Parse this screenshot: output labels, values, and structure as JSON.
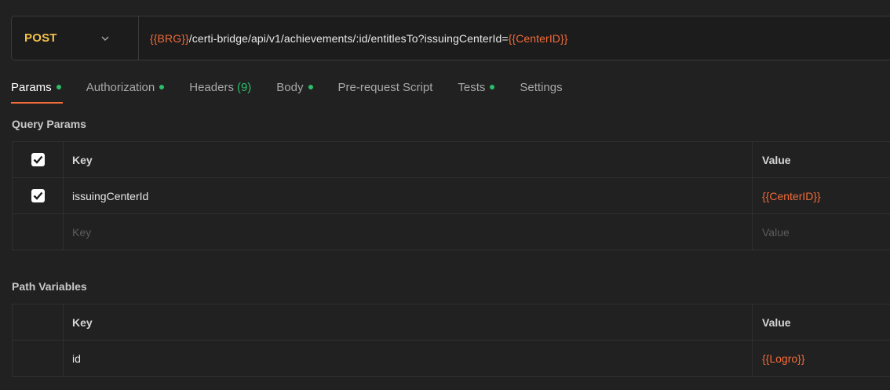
{
  "request": {
    "method": "POST",
    "url_var_start": "{{BRG}}",
    "url_path": "/certi-bridge/api/v1/achievements/:id/entitlesTo?issuingCenterId=",
    "url_var_end": "{{CenterID}}"
  },
  "tabs": [
    {
      "label": "Params",
      "active": true,
      "dot": true
    },
    {
      "label": "Authorization",
      "dot": true
    },
    {
      "label": "Headers",
      "count": "(9)"
    },
    {
      "label": "Body",
      "dot": true
    },
    {
      "label": "Pre-request Script"
    },
    {
      "label": "Tests",
      "dot": true
    },
    {
      "label": "Settings"
    }
  ],
  "query_params": {
    "title": "Query Params",
    "header": {
      "key": "Key",
      "value": "Value",
      "checked": true
    },
    "rows": [
      {
        "key": "issuingCenterId",
        "value": "{{CenterID}}",
        "checked": true
      }
    ],
    "new_row": {
      "key_placeholder": "Key",
      "value_placeholder": "Value"
    }
  },
  "path_variables": {
    "title": "Path Variables",
    "header": {
      "key": "Key",
      "value": "Value"
    },
    "rows": [
      {
        "key": "id",
        "value": "{{Logro}}"
      }
    ]
  },
  "colors": {
    "method": "#f5c14a",
    "variable": "#f26b3a",
    "status_dot": "#2bbd6a",
    "active_tab_underline": "#f26b3a"
  },
  "icons": {
    "method_dropdown": "chevron-down-icon",
    "checkbox": "checkmark-icon"
  }
}
